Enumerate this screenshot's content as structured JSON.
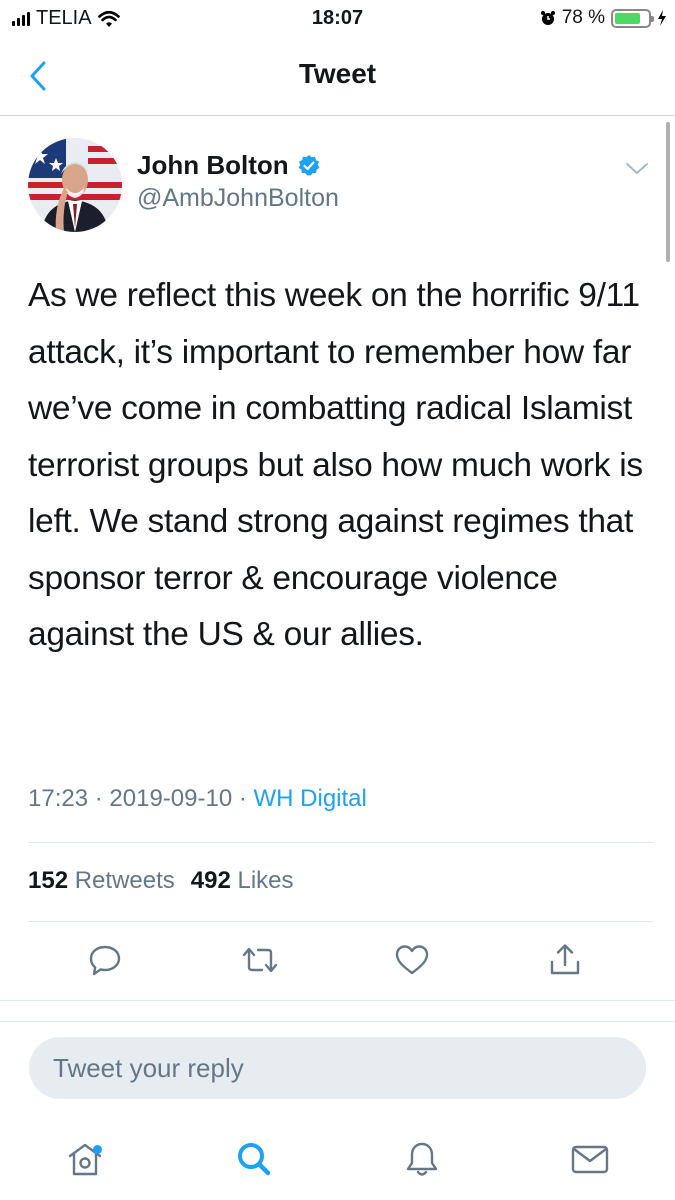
{
  "status_bar": {
    "carrier": "TELIA",
    "time": "18:07",
    "battery_percent": "78 %",
    "battery_level": 0.78
  },
  "header": {
    "title": "Tweet",
    "back_icon": "chevron-left-icon"
  },
  "tweet": {
    "author_name": "John Bolton",
    "author_handle": "@AmbJohnBolton",
    "verified": true,
    "text": "As we reflect this week on the horrific 9/11 attack, it’s important to remember how far we’ve come in combatting radical Islamist terrorist groups but also how much work is left. We stand strong against regimes that sponsor terror & encourage violence against the US & our allies.",
    "time": "17:23",
    "date": "2019-09-10",
    "separator": "·",
    "source": "WH Digital",
    "retweet_count": "152",
    "retweet_label": "Retweets",
    "like_count": "492",
    "like_label": "Likes"
  },
  "actions": [
    "reply-icon",
    "retweet-icon",
    "like-icon",
    "share-icon"
  ],
  "reply": {
    "placeholder": "Tweet your reply"
  },
  "tabbar": [
    "home-icon",
    "search-icon",
    "notifications-icon",
    "messages-icon"
  ],
  "colors": {
    "accent": "#1da1f2",
    "secondary_text": "#657786",
    "battery": "#4cd964"
  }
}
